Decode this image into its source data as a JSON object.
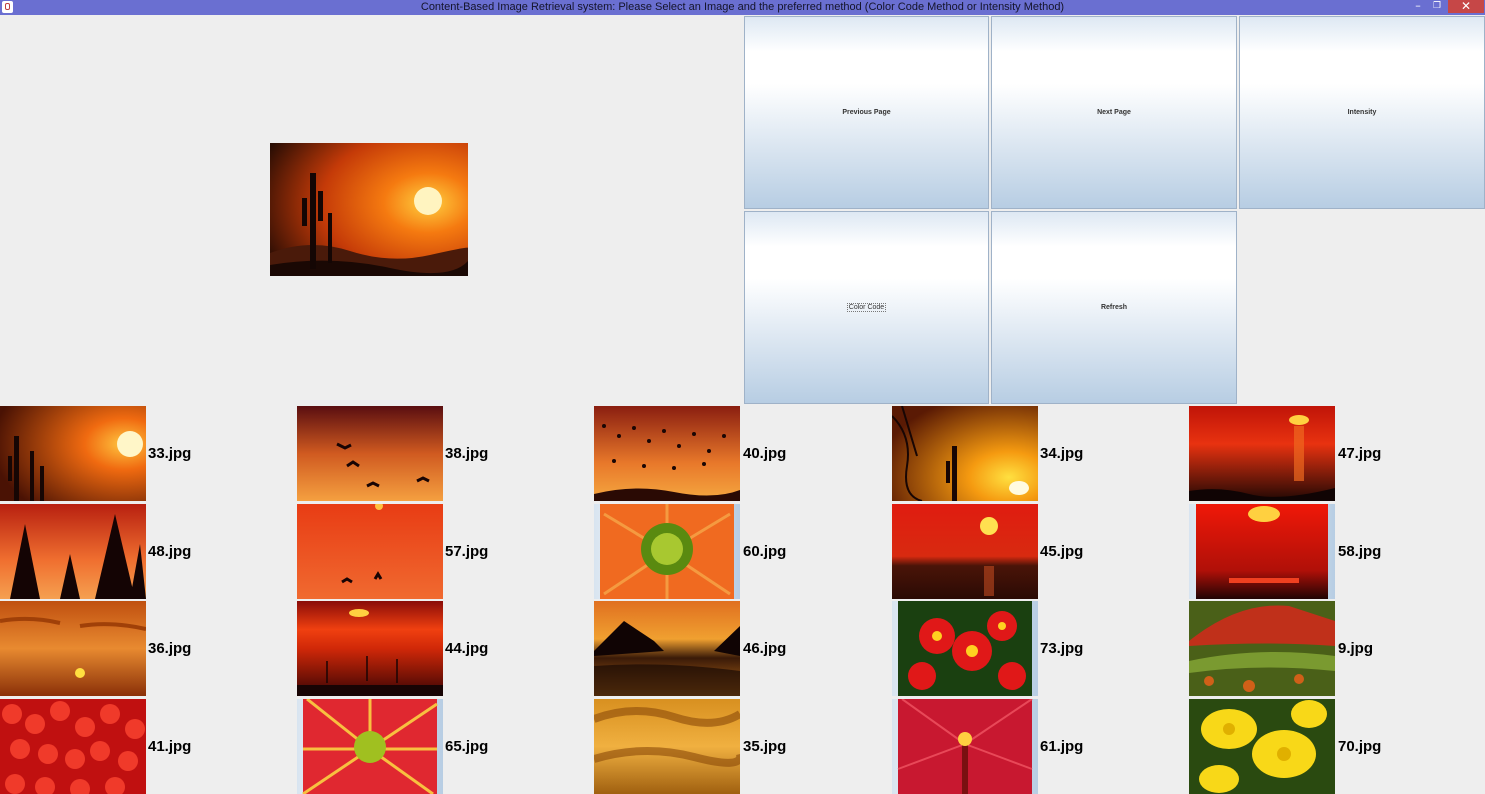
{
  "window": {
    "title": "Content-Based Image Retrieval system: Please Select an Image and the preferred method (Color Code Method or Intensity Method)",
    "minimize_glyph": "–",
    "maximize_glyph": "❐",
    "close_glyph": "✕"
  },
  "preview": {
    "icon": "selected-image-preview"
  },
  "buttons": {
    "previous": "Previous Page",
    "next": "Next Page",
    "intensity": "Intensity",
    "color_code": "Color Code",
    "refresh": "Refresh"
  },
  "grid": {
    "rows": [
      [
        "33.jpg",
        "38.jpg",
        "40.jpg",
        "34.jpg",
        "47.jpg"
      ],
      [
        "48.jpg",
        "57.jpg",
        "60.jpg",
        "45.jpg",
        "58.jpg"
      ],
      [
        "36.jpg",
        "44.jpg",
        "46.jpg",
        "73.jpg",
        "9.jpg"
      ],
      [
        "41.jpg",
        "65.jpg",
        "35.jpg",
        "61.jpg",
        "70.jpg"
      ]
    ]
  },
  "colors": {
    "titlebar": "#6a6fd1",
    "close": "#c64747",
    "background": "#eeeeee"
  }
}
